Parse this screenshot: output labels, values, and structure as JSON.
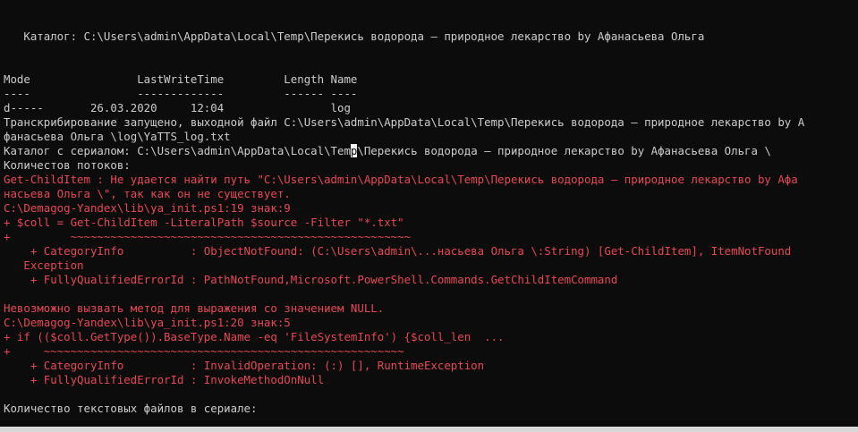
{
  "terminal": {
    "colors": {
      "background": "#0c0c0c",
      "text": "#cccccc",
      "error": "#e74856"
    },
    "catalog_line": "   Каталог: C:\\Users\\admin\\AppData\\Local\\Temp\\Перекись водорода – природное лекарство by Афанасьева Ольга",
    "table_header": "Mode                LastWriteTime         Length Name",
    "table_rule": "----                -------------         ------ ----",
    "table_row": "d-----       26.03.2020     12:04                log",
    "transcription_1": "Транскрибирование запущено, выходной файл C:\\Users\\admin\\AppData\\Local\\Temp\\Перекись водорода – природное лекарство by А",
    "transcription_2": "фанасьева Ольга \\log\\YaTTS_log.txt",
    "serial_catalog_pre": "Каталог с сериалом: C:\\Users\\admin\\AppData\\Local\\Tem",
    "serial_catalog_cursor": "p",
    "serial_catalog_post": "\\Перекись водорода – природное лекарство by Афанасьева Ольга \\",
    "threads": "Количестов потоков:",
    "error1": {
      "line1": "Get-ChildItem : Не удается найти путь \"C:\\Users\\admin\\AppData\\Local\\Temp\\Перекись водорода – природное лекарство by Афа",
      "line2": "насьева Ольга \\\", так как он не существует.",
      "location": "C:\\Demagog-Yandex\\lib\\ya_init.ps1:19 знак:9",
      "code": "+ $coll = Get-ChildItem -LiteralPath $source -Filter \"*.txt\"",
      "underline": "+         ~~~~~~~~~~~~~~~~~~~~~~~~~~~~~~~~~~~~~~~~~~~~~~~~~~~",
      "category": "    + CategoryInfo          : ObjectNotFound: (C:\\Users\\admin\\...насьева Ольга \\:String) [Get-ChildItem], ItemNotFound",
      "category_cont": "   Exception",
      "fqid": "    + FullyQualifiedErrorId : PathNotFound,Microsoft.PowerShell.Commands.GetChildItemCommand"
    },
    "error2": {
      "message": "Невозможно вызвать метод для выражения со значением NULL.",
      "location": "C:\\Demagog-Yandex\\lib\\ya_init.ps1:20 знак:5",
      "code": "+ if (($coll.GetType()).BaseType.Name -eq 'FileSystemInfo') {$coll_len  ...",
      "underline": "+     ~~~~~~~~~~~~~~~~~~~~~~~~~~~~~~~~~~~~~~~~~~~~~~~~~~~~~~",
      "category": "    + CategoryInfo          : InvalidOperation: (:) [], RuntimeException",
      "fqid": "    + FullyQualifiedErrorId : InvokeMethodOnNull"
    },
    "text_files_count": "Количество текстовых файлов в сериале:"
  }
}
